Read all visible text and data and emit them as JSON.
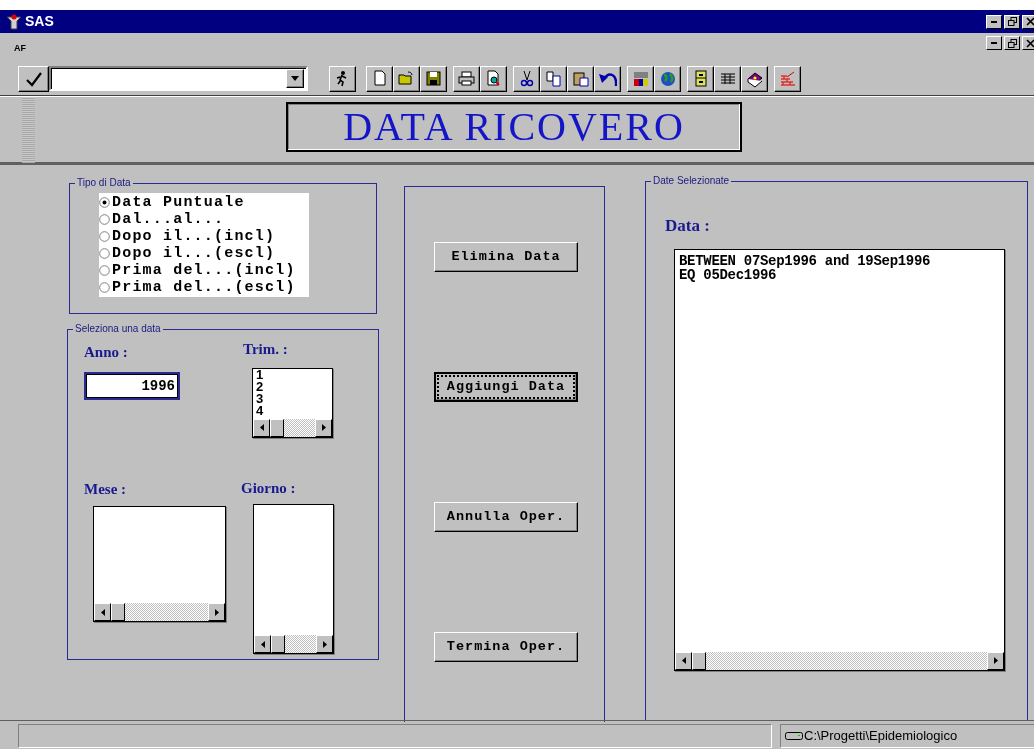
{
  "window": {
    "title": "SAS"
  },
  "inner_window": {
    "title": "AF"
  },
  "banner": {
    "title": "DATA RICOVERO"
  },
  "date_type_group": {
    "label": "Tipo di Data",
    "options": [
      {
        "label": "Data Puntuale",
        "selected": true
      },
      {
        "label": "Dal...al...",
        "selected": false
      },
      {
        "label": "Dopo il...(incl)",
        "selected": false
      },
      {
        "label": "Dopo il...(escl)",
        "selected": false
      },
      {
        "label": "Prima del...(incl)",
        "selected": false
      },
      {
        "label": "Prima del...(escl)",
        "selected": false
      }
    ]
  },
  "select_date_group": {
    "label": "Seleziona una data",
    "year_label": "Anno :",
    "year_value": "1996",
    "quarter_label": "Trim. :",
    "quarters": [
      "1",
      "2",
      "3",
      "4"
    ],
    "month_label": "Mese :",
    "day_label": "Giorno :"
  },
  "actions": [
    {
      "label": "Elimina Data",
      "focused": false
    },
    {
      "label": "Aggiungi Data",
      "focused": true
    },
    {
      "label": "Annulla Oper.",
      "focused": false
    },
    {
      "label": "Termina Oper.",
      "focused": false
    }
  ],
  "selected_dates_group": {
    "label": "Date Selezionate",
    "data_label": "Data :",
    "items": [
      "BETWEEN 07Sep1996 and 19Sep1996",
      "EQ 05Dec1996"
    ]
  },
  "status_bar": {
    "path": "C:\\Progetti\\Epidemiologico"
  }
}
